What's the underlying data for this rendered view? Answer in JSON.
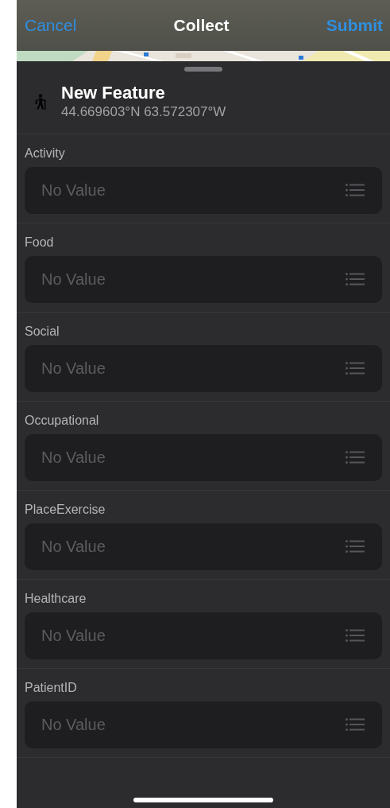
{
  "nav_bar": {
    "cancel": "Cancel",
    "title": "Collect",
    "submit": "Submit"
  },
  "feature": {
    "title": "New Feature",
    "coordinates": "44.669603°N  63.572307°W"
  },
  "fields": [
    {
      "label": "Activity",
      "placeholder": "No Value"
    },
    {
      "label": "Food",
      "placeholder": "No Value"
    },
    {
      "label": "Social",
      "placeholder": "No Value"
    },
    {
      "label": "Occupational",
      "placeholder": "No Value"
    },
    {
      "label": "PlaceExercise",
      "placeholder": "No Value"
    },
    {
      "label": "Healthcare",
      "placeholder": "No Value"
    },
    {
      "label": "PatientID",
      "placeholder": "No Value"
    }
  ]
}
